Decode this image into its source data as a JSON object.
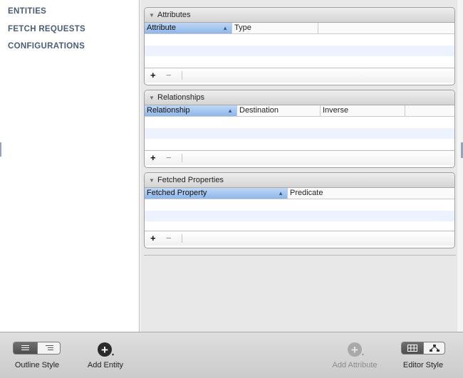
{
  "sidebar": {
    "items": [
      {
        "label": "ENTITIES"
      },
      {
        "label": "FETCH REQUESTS"
      },
      {
        "label": "CONFIGURATIONS"
      }
    ]
  },
  "sections": {
    "attributes": {
      "title": "Attributes",
      "columns": [
        "Attribute",
        "Type"
      ],
      "sorted_column": "Attribute"
    },
    "relationships": {
      "title": "Relationships",
      "columns": [
        "Relationship",
        "Destination",
        "Inverse"
      ],
      "sorted_column": "Relationship"
    },
    "fetched_properties": {
      "title": "Fetched Properties",
      "columns": [
        "Fetched Property",
        "Predicate"
      ],
      "sorted_column": "Fetched Property"
    }
  },
  "footer_buttons": {
    "add": "+",
    "remove": "−"
  },
  "toolbar": {
    "outline_style": "Outline Style",
    "add_entity": "Add Entity",
    "add_attribute": "Add Attribute",
    "editor_style": "Editor Style"
  },
  "glyphs": {
    "disclosure": "▼",
    "sort_ascending": "▲",
    "add_circle": "+",
    "dropdown_caret": "▾"
  },
  "colors": {
    "sidebar_text": "#4a5c78",
    "sort_header": "#8db6ea",
    "alt_row": "#edf3fe",
    "disabled_text": "#8c8c8c"
  }
}
